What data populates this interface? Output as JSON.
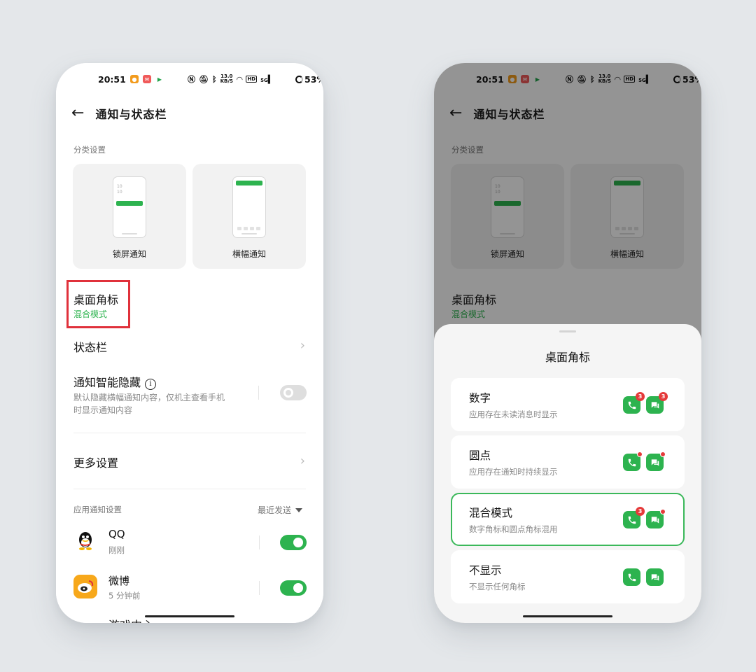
{
  "status_bar": {
    "time": "20:51",
    "speed_value": "13.0",
    "speed_unit": "KB/S",
    "network": "HD",
    "signal": "5G",
    "battery": "53%"
  },
  "header": {
    "title": "通知与状态栏"
  },
  "category_section": {
    "label": "分类设置",
    "cards": [
      {
        "label": "锁屏通知"
      },
      {
        "label": "横幅通知"
      }
    ],
    "mini_clock_line1": "10",
    "mini_clock_line2": "10"
  },
  "badge_row": {
    "title": "桌面角标",
    "value": "混合模式"
  },
  "status_bar_row": {
    "title": "状态栏"
  },
  "smart_hide": {
    "title": "通知智能隐藏",
    "info_glyph": "i",
    "desc_line1": "默认隐藏横幅通知内容，仅机主查看手机",
    "desc_line2": "时显示通知内容",
    "enabled": false
  },
  "more_settings": {
    "title": "更多设置"
  },
  "app_notifications": {
    "label": "应用通知设置",
    "sort_label": "最近发送",
    "apps": [
      {
        "name": "QQ",
        "time": "刚刚",
        "enabled": true
      },
      {
        "name": "微博",
        "time": "5 分钟前",
        "enabled": true
      }
    ],
    "cutoff_text": "游戏中心"
  },
  "sheet": {
    "title": "桌面角标",
    "badge_count": "3",
    "options": [
      {
        "title": "数字",
        "desc": "应用存在未读消息时显示",
        "badge": "number",
        "selected": false
      },
      {
        "title": "圆点",
        "desc": "应用存在通知时持续显示",
        "badge": "dot",
        "selected": false
      },
      {
        "title": "混合模式",
        "desc": "数字角标和圆点角标混用",
        "badge": "mixed",
        "selected": true
      },
      {
        "title": "不显示",
        "desc": "不显示任何角标",
        "badge": "none",
        "selected": false
      }
    ]
  },
  "colors": {
    "accent": "#2db34f",
    "highlight": "#e0313b",
    "badge_red": "#e53a3a"
  },
  "icons": [
    "back-arrow-icon",
    "chevron-right-icon",
    "info-icon",
    "caret-down-icon",
    "qq-icon",
    "weibo-icon",
    "phone-icon",
    "message-icon"
  ]
}
